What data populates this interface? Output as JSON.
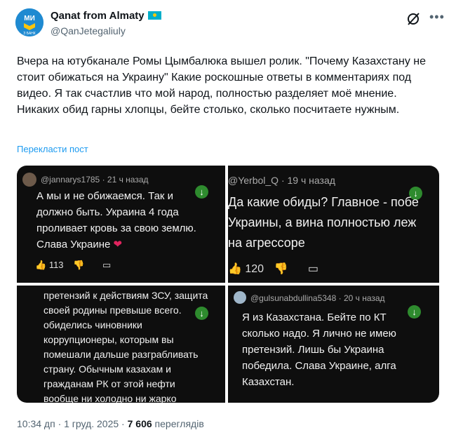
{
  "author": {
    "name": "Qanat from Almaty",
    "handle": "@QanJetegaliuly",
    "avatar_text": "МИ",
    "avatar_subtext": "З БАНК"
  },
  "tweet": {
    "text": "Вчера на ютубканале Ромы Цымбалюка вышел ролик. \"Почему Казахстану не стоит обижаться на Украину\" Какие роскошные ответы в комментариях под видео. Я так счастлив что мой народ, полностью разделяет моё мнение. Никаких обид гарны хлопцы, бейте столько, сколько посчитаете нужным.",
    "translate_label": "Перекласти пост"
  },
  "media": {
    "comment1": {
      "header": "@jannarys1785 · 21 ч назад",
      "body": "А мы и не обижаемся. Так и\nдолжно быть. Украина 4 года\nпроливает кровь за свою землю.\nСлава Украине",
      "heart": "❤",
      "likes": "113"
    },
    "comment2": {
      "header": "@Yerbol_Q · 19 ч назад",
      "body": "Да какие обиды? Главное - побе\nУкраины, а вина полностью леж\nна агрессоре",
      "likes": "120"
    },
    "comment3": {
      "body": "претензий к действиям ЗСУ, защита\nсвоей родины превыше всего.\nобиделись чиновники\nкоррупционеры, которым вы\nпомешали дальше разграбливать\nстрану. Обычным казахам и\nгражданам РК от этой нефти\nвообще ни холодно ни жарко"
    },
    "comment4": {
      "header": "@gulsunabdullina5348 · 20 ч назад",
      "body": "Я из Казахстана. Бейте по КТ\nсколько надо. Я лично не имею\nпретензий. Лишь бы Украина\nпобедила. Слава Украине, алга\nКазахстан."
    }
  },
  "footer": {
    "meta": "10:34 дп · 1 груд. 2025 · ",
    "views_count": "7 606",
    "views_label": " переглядів"
  },
  "colors": {
    "link": "#1d9bf0",
    "secondary_text": "#536471",
    "panel_bg": "#0e0e0e",
    "download_badge": "#2e8b2e",
    "kz_flag": "#00afca"
  }
}
